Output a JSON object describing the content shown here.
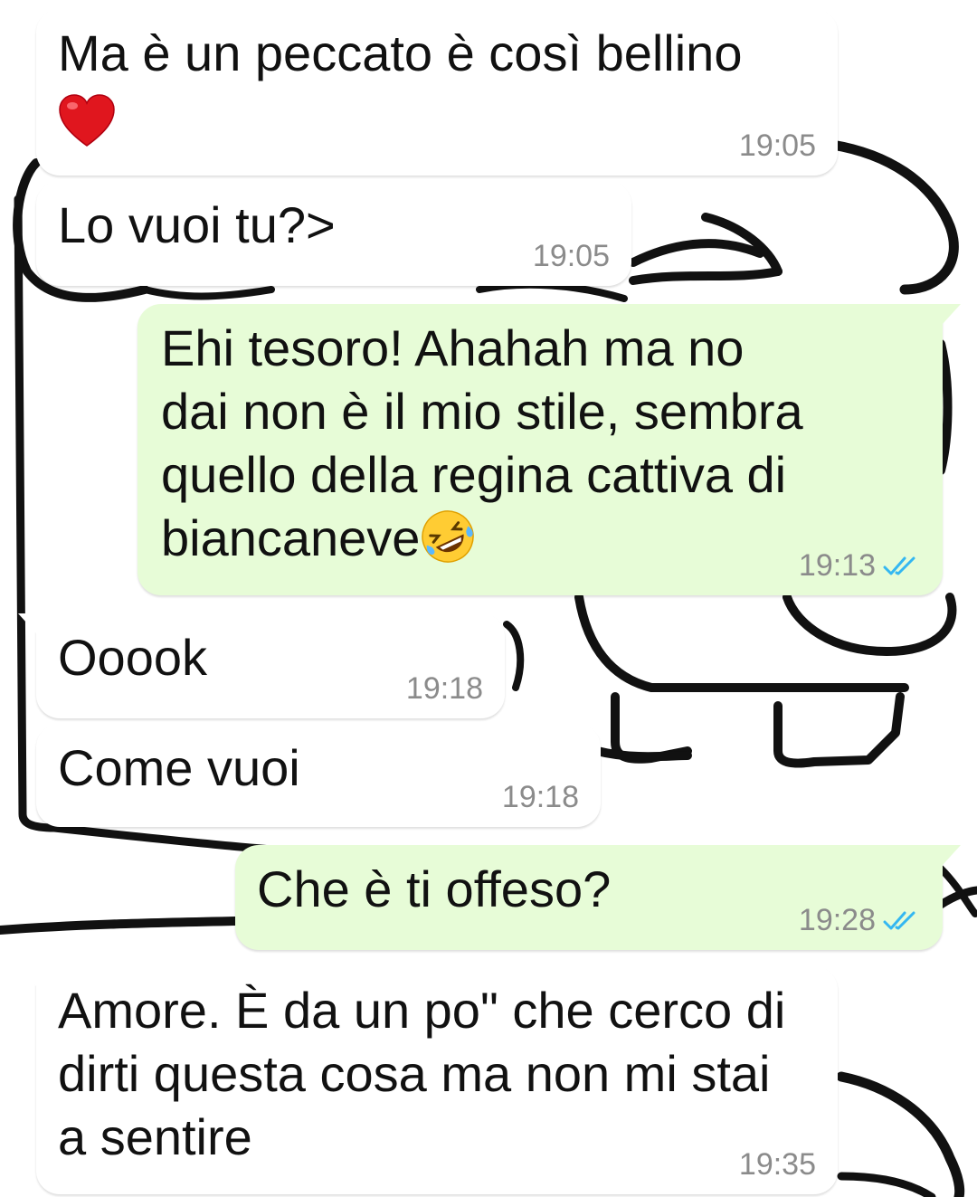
{
  "colors": {
    "incoming_bubble": "#ffffff",
    "outgoing_bubble": "#e7fcd7",
    "timestamp": "#8b8b8b",
    "read_ticks": "#34b7f1"
  },
  "messages": [
    {
      "direction": "in",
      "text": "Ma è un peccato è così bellino",
      "emoji": "red-heart",
      "time": "19:05"
    },
    {
      "direction": "in",
      "text": "Lo vuoi tu?>",
      "time": "19:05"
    },
    {
      "direction": "out",
      "text_before_emoji": "Ehi tesoro! Ahahah ma no\ndai non è il mio stile, sembra\nquello della regina cattiva di\nbiancaneve",
      "emoji": "rolling-on-floor-laughing",
      "time": "19:13",
      "status": "read"
    },
    {
      "direction": "in",
      "text": "Ooook",
      "time": "19:18"
    },
    {
      "direction": "in",
      "text": "Come vuoi",
      "time": "19:18"
    },
    {
      "direction": "out",
      "text": "Che è ti offeso?",
      "time": "19:28",
      "status": "read"
    },
    {
      "direction": "in",
      "text": "Amore. È da un po\" che cerco di\ndirti questa cosa ma non mi stai\na sentire",
      "time": "19:35"
    }
  ]
}
